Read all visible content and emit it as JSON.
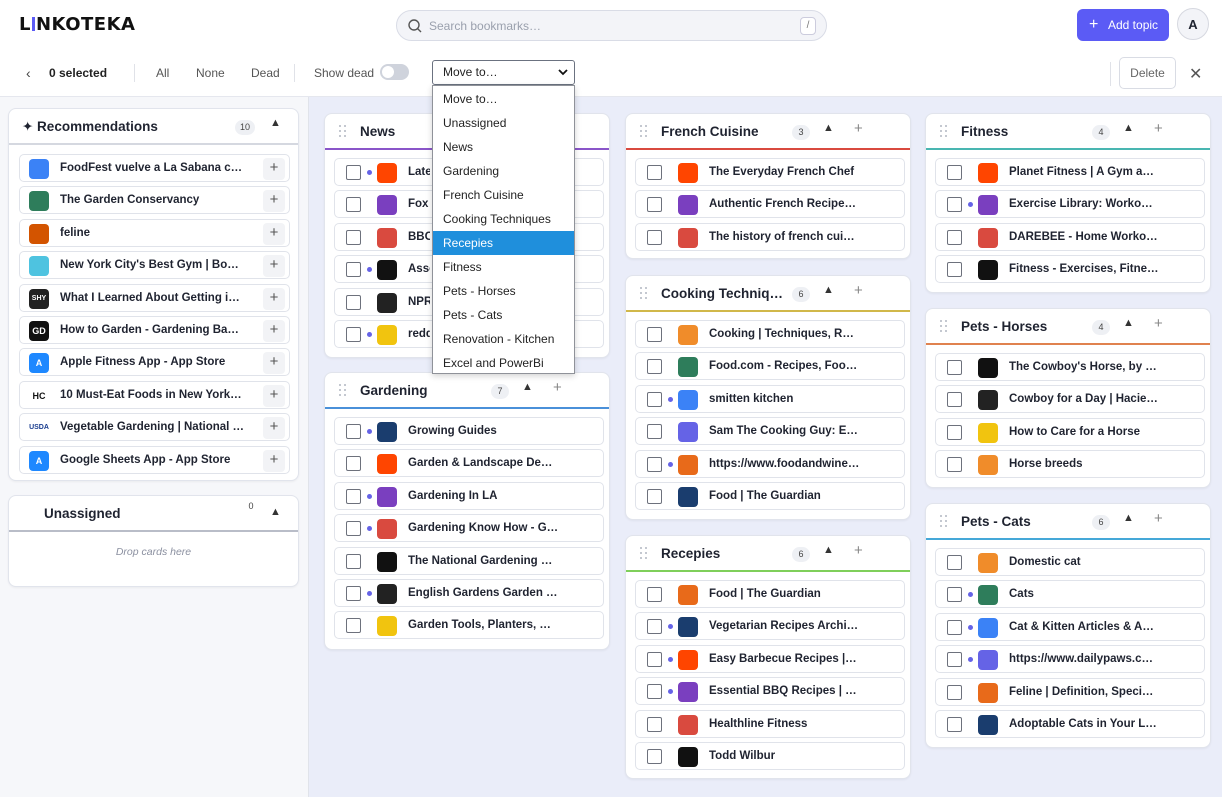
{
  "app": {
    "logo": "LINKOTEKA"
  },
  "search": {
    "placeholder": "Search bookmarks…",
    "shortcut": "/"
  },
  "header": {
    "add_topic": "Add topic",
    "avatar": "A"
  },
  "toolbar": {
    "selected": "0 selected",
    "all": "All",
    "none": "None",
    "dead": "Dead",
    "show_dead": "Show dead",
    "move_to": "Move to…",
    "delete": "Delete"
  },
  "move_menu": {
    "options": [
      "Move to…",
      "Unassigned",
      "News",
      "Gardening",
      "French Cuisine",
      "Cooking Techniques",
      "Recepies",
      "Fitness",
      "Pets - Horses",
      "Pets - Cats",
      "Renovation - Kitchen",
      "Excel and PowerBi"
    ],
    "highlighted": "Recepies"
  },
  "recommendations": {
    "title": "✦ Recommendations",
    "count": "10",
    "items": [
      "FoodFest vuelve a La Sabana c…",
      "The Garden Conservancy",
      "feline",
      "New York City's Best Gym | Bo…",
      "What I Learned About Getting i…",
      "How to Garden - Gardening Ba…",
      "Apple Fitness App - App Store",
      "10 Must-Eat Foods in New York…",
      "Vegetable Gardening | National …",
      "Google Sheets App - App Store"
    ]
  },
  "unassigned": {
    "title": "Unassigned",
    "count": "0",
    "empty": "Drop cards here"
  },
  "columns": {
    "news": {
      "title": "News",
      "items": [
        "Late",
        "Fox",
        "BBC",
        "Asso",
        "NPR",
        "redd"
      ]
    },
    "gardening": {
      "title": "Gardening",
      "count": "7",
      "items": [
        "Growing Guides",
        "Garden & Landscape De…",
        "Gardening In LA",
        "Gardening Know How - G…",
        "The National Gardening …",
        "English Gardens Garden …",
        "Garden Tools, Planters, …"
      ]
    },
    "french": {
      "title": "French Cuisine",
      "count": "3",
      "items": [
        "The Everyday French Chef",
        "Authentic French Recipe…",
        "The history of french cui…"
      ]
    },
    "cooking": {
      "title": "Cooking Techniq…",
      "count": "6",
      "items": [
        "Cooking | Techniques, R…",
        "Food.com - Recipes, Foo…",
        "smitten kitchen",
        "Sam The Cooking Guy: E…",
        "https://www.foodandwine…",
        "Food | The Guardian"
      ]
    },
    "recepies": {
      "title": "Recepies",
      "count": "6",
      "items": [
        "Food | The Guardian",
        "Vegetarian Recipes Archi…",
        "Easy Barbecue Recipes |…",
        "Essential BBQ Recipes | …",
        "Healthline Fitness",
        "Todd Wilbur"
      ]
    },
    "fitness": {
      "title": "Fitness",
      "count": "4",
      "items": [
        "Planet Fitness | A Gym a…",
        "Exercise Library: Worko…",
        "DAREBEE - Home Worko…",
        "Fitness - Exercises, Fitne…"
      ]
    },
    "horses": {
      "title": "Pets - Horses",
      "count": "4",
      "items": [
        "The Cowboy's Horse, by …",
        "Cowboy for a Day | Hacie…",
        "How to Care for a Horse",
        "Horse breeds"
      ]
    },
    "cats": {
      "title": "Pets - Cats",
      "count": "6",
      "items": [
        "Domestic cat",
        "Cats",
        "Cat & Kitten Articles & A…",
        "https://www.dailypaws.c…",
        "Feline | Definition, Speci…",
        "Adoptable Cats in Your L…"
      ]
    }
  }
}
